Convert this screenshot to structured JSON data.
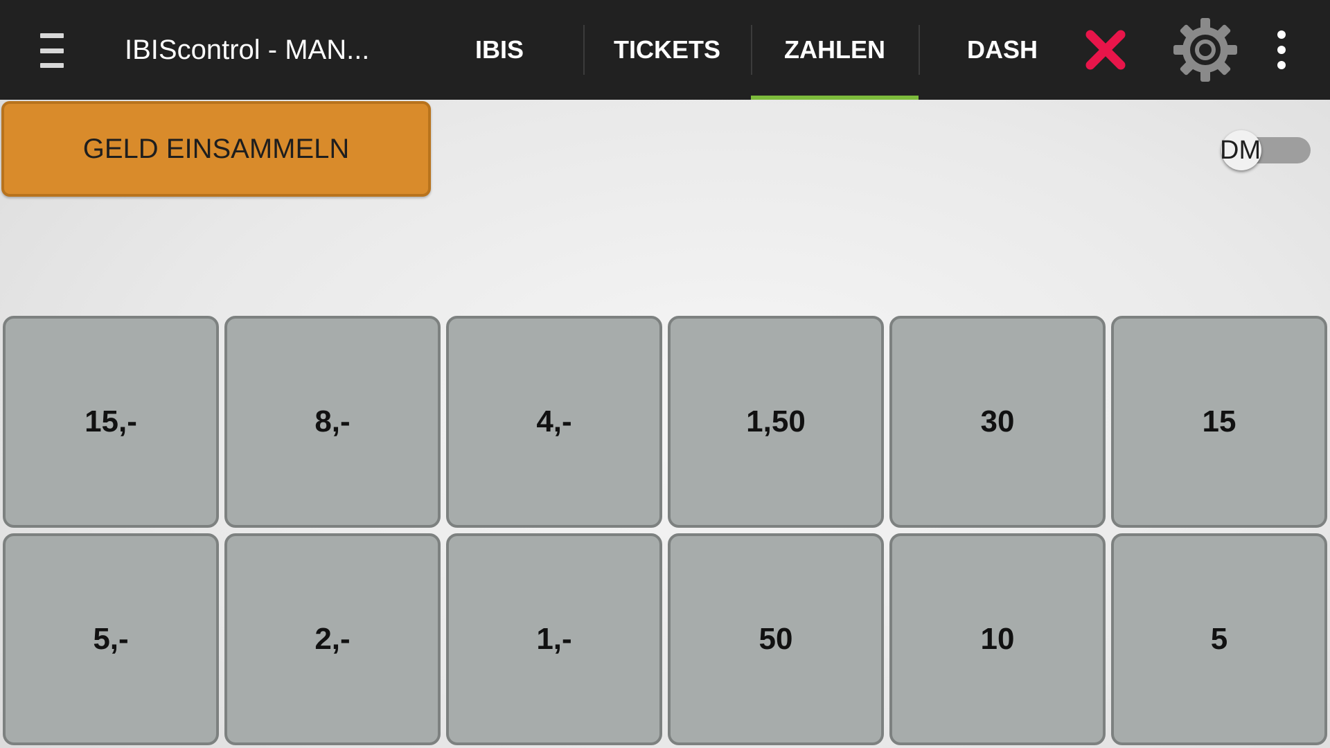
{
  "header": {
    "title": "IBIScontrol - MAN...",
    "menu_icon": "hamburger-menu-icon",
    "tabs": [
      {
        "label": "IBIS",
        "active": false
      },
      {
        "label": "TICKETS",
        "active": false
      },
      {
        "label": "ZAHLEN",
        "active": true
      },
      {
        "label": "DASH",
        "active": false
      }
    ],
    "actions": {
      "close_icon": "close-icon",
      "close_color": "#e8154a",
      "settings_icon": "gear-icon",
      "overflow_icon": "more-vertical-icon"
    },
    "accent_color": "#7dbb3c"
  },
  "main": {
    "collect_button": {
      "label": "GELD EINSAMMELN",
      "color": "#d98b2b"
    },
    "currency_toggle": {
      "label": "DM",
      "checked": false
    },
    "keypad": {
      "rows": [
        [
          "15,-",
          "8,-",
          "4,-",
          "1,50",
          "30",
          "15"
        ],
        [
          "5,-",
          "2,-",
          "1,-",
          "50",
          "10",
          "5"
        ]
      ]
    }
  }
}
